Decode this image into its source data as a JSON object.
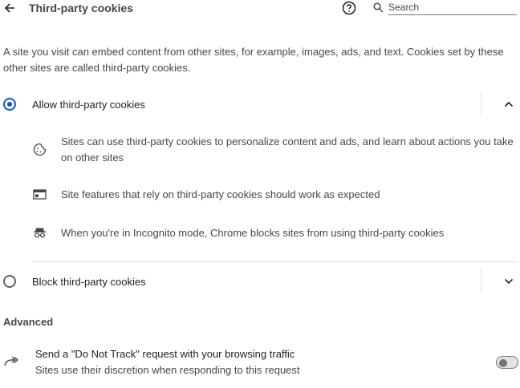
{
  "header": {
    "title": "Third-party cookies",
    "search_placeholder": "Search"
  },
  "intro": "A site you visit can embed content from other sites, for example, images, ads, and text. Cookies set by these other sites are called third-party cookies.",
  "options": {
    "allow": {
      "label": "Allow third-party cookies",
      "selected": true,
      "details": [
        {
          "icon": "cookie-icon",
          "text": "Sites can use third-party cookies to personalize content and ads, and learn about actions you take on other sites"
        },
        {
          "icon": "web-page-icon",
          "text": "Site features that rely on third-party cookies should work as expected"
        },
        {
          "icon": "incognito-icon",
          "text": "When you're in Incognito mode, Chrome blocks sites from using third-party cookies"
        }
      ]
    },
    "block": {
      "label": "Block third-party cookies",
      "selected": false
    }
  },
  "advanced": {
    "heading": "Advanced",
    "dnt_title": "Send a \"Do Not Track\" request with your browsing traffic",
    "dnt_sub": "Sites use their discretion when responding to this request",
    "dnt_enabled": false
  },
  "colors": {
    "accent": "#0b57d0",
    "text": "#1f1f1f",
    "secondary_text": "#474747"
  }
}
